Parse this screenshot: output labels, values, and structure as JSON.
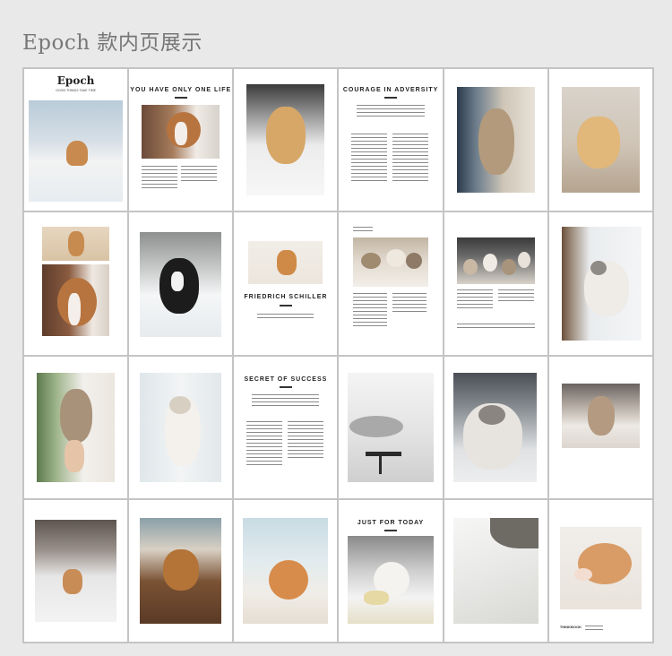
{
  "page_title": "Epoch 款内页展示",
  "cover": {
    "logo": "Epoch",
    "tagline": "GOOD THINGS TAKE TIME"
  },
  "headings": {
    "p2": "YOU HAVE ONLY ONE LIFE",
    "p4": "COURAGE IN ADVERSITY",
    "p9": "FRIEDRICH SCHILLER",
    "p15": "SECRET OF SUCCESS",
    "p22": "JUST FOR TODAY"
  },
  "footer_label": "THINKBOOK",
  "colors": {
    "background": "#e9e9e9",
    "grid_border": "#c4c4c4",
    "title": "#777777"
  },
  "photos": [
    "snow-dog",
    "spaniel-puppy",
    "golden-puppy-white-bg",
    "tabby-cat",
    "golden-puppy-floor",
    "shiba-dog",
    "spaniel-dog",
    "bernese-snow-dog",
    "corgi-dog",
    "cats-group",
    "kittens-group",
    "ragdoll-cat-window",
    "kitten-hand",
    "siamese-kitten",
    "cat-on-chair",
    "blue-eyed-cat",
    "tabby-on-bed",
    "running-dog-snow",
    "retriever-puppy-couch",
    "orange-cat",
    "white-cat-paw",
    "cat-blanket",
    "sleeping-orange-cat"
  ]
}
